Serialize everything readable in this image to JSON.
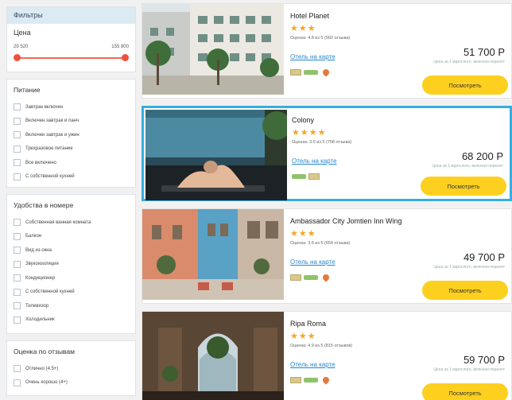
{
  "sidebar": {
    "filters_title": "Фильтры",
    "price": {
      "title": "Цена",
      "min": "29 520",
      "max": "155 800"
    },
    "food": {
      "title": "Питание",
      "options": [
        "Завтрак включен",
        "Включен завтрак и ланч",
        "Включен завтрак и ужин",
        "Трехразовое питание",
        "Все включено",
        "С собственной кухней"
      ]
    },
    "amenities": {
      "title": "Удобства в номере",
      "options": [
        "Собственная ванная комната",
        "Балкон",
        "Вид из окна",
        "Звукоизоляция",
        "Кондиционер",
        "С собственной кухней",
        "Телевизор",
        "Холодильник"
      ]
    },
    "rating": {
      "title": "Оценка по отзывам",
      "options": [
        "Отлично (4.5+)",
        "Очень хорошо (4+)"
      ]
    }
  },
  "hotels": [
    {
      "name": "Hotel Planet",
      "stars": "★★★",
      "rating": "Оценка: 4.8 из 5 (902 отзыва)",
      "map_link": "Отель на карте",
      "price": "51 700 Р",
      "price_note": "Цена за 1 взрослого, включая перелет",
      "button": "Посмотреть"
    },
    {
      "name": "Colony",
      "stars": "★★★★",
      "rating": "Оценка: 3.5 из 5 (758 отзыва)",
      "map_link": "Отель на карте",
      "price": "68 200 Р",
      "price_note": "Цена за 1 взрослого, включая перелет",
      "button": "Посмотреть"
    },
    {
      "name": "Ambassador City Jomtien Inn Wing",
      "stars": "★★★",
      "rating": "Оценка: 3.6 из 5 (654 отзыва)",
      "map_link": "Отель на карте",
      "price": "49 700 Р",
      "price_note": "Цена за 1 взрослого, включая перелет",
      "button": "Посмотреть"
    },
    {
      "name": "Ripa Roma",
      "stars": "★★★",
      "rating": "Оценка: 4.9 из 5 (815 отзывов)",
      "map_link": "Отель на карте",
      "price": "59 700 Р",
      "price_note": "Цена за 1 взрослого, включая перелет",
      "button": "Посмотреть"
    }
  ],
  "colors": {
    "accent_blue": "#35aee0",
    "button_yellow": "#fdd020",
    "slider_red": "#f04f3c",
    "star_orange": "#f5a623",
    "link_blue": "#2a86c9"
  }
}
